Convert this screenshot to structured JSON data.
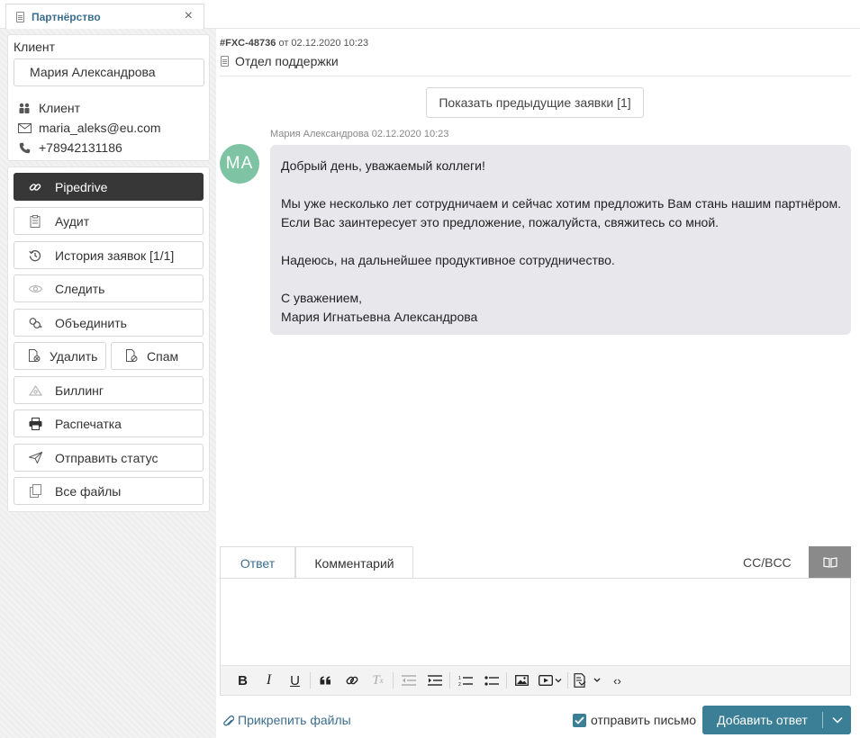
{
  "tab": {
    "label": "Партнёрство",
    "close": "×"
  },
  "client": {
    "title": "Клиент",
    "name": "Мария Александрова",
    "type": "Клиент",
    "email": "maria_aleks@eu.com",
    "phone": "+78942131186"
  },
  "actions": {
    "pipedrive": "Pipedrive",
    "audit": "Аудит",
    "history": "История заявок [1/1]",
    "follow": "Следить",
    "merge": "Объединить",
    "delete": "Удалить",
    "spam": "Спам",
    "billing": "Биллинг",
    "print": "Распечатка",
    "send_status": "Отправить статус",
    "all_files": "Все файлы"
  },
  "ticket": {
    "id": "#FXC-48736",
    "from_word": "от",
    "date": "02.12.2020 10:23",
    "department": "Отдел поддержки",
    "prev_button": "Показать предыдущие заявки [1]"
  },
  "message": {
    "meta": "Мария Александрова 02.12.2020 10:23",
    "avatar": "МА",
    "p1": "Добрый день, уважаемый коллеги!",
    "p2": "Мы уже несколько лет сотрудничаем и сейчас хотим предложить Вам стань нашим партнёром. Если Вас заинтересует это предложение, пожалуйста, свяжитесь со мной.",
    "p3": "Надеюсь, на дальнейшее продуктивное сотрудничество.",
    "sign1": "С уважением,",
    "sign2": "Мария Игнатьевна Александрова"
  },
  "reply": {
    "tab_answer": "Ответ",
    "tab_comment": "Комментарий",
    "ccbcc": "CC/BCC",
    "attach": "Прикрепить файлы",
    "send_mail": "отправить письмо",
    "submit": "Добавить ответ"
  },
  "colors": {
    "accent": "#3b7f96",
    "link": "#3b6e8f",
    "avatar": "#7ec4a4",
    "dark_button": "#373737"
  }
}
